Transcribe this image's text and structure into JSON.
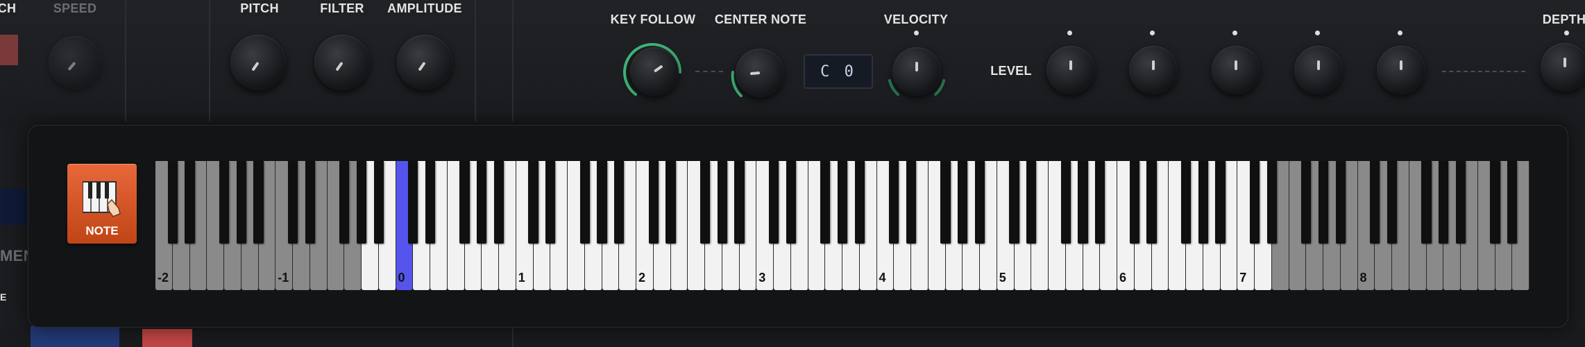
{
  "top_labels": {
    "left_partial": "CH",
    "speed": "SPEED",
    "pitch": "PITCH",
    "filter": "FILTER",
    "amplitude": "AMPLITUDE",
    "key_follow": "KEY FOLLOW",
    "center_note": "CENTER NOTE",
    "velocity": "VELOCITY",
    "level": "LEVEL",
    "depth": "DEPTH"
  },
  "center_note_value": "C 0",
  "side_labels": {
    "menu_partial": "MEN",
    "small_partial": "E"
  },
  "note_button": {
    "label": "NOTE"
  },
  "keyboard": {
    "selected_octave": "0",
    "octave_labels": [
      "-2",
      "-1",
      "0",
      "1",
      "2",
      "3",
      "4",
      "5",
      "6",
      "7",
      "8"
    ]
  },
  "icons": {
    "note": "piano-keys-hand-icon"
  },
  "colors": {
    "accent_green": "#3fb77a",
    "selected_key": "#5555ee",
    "note_button": "#d9552a"
  }
}
